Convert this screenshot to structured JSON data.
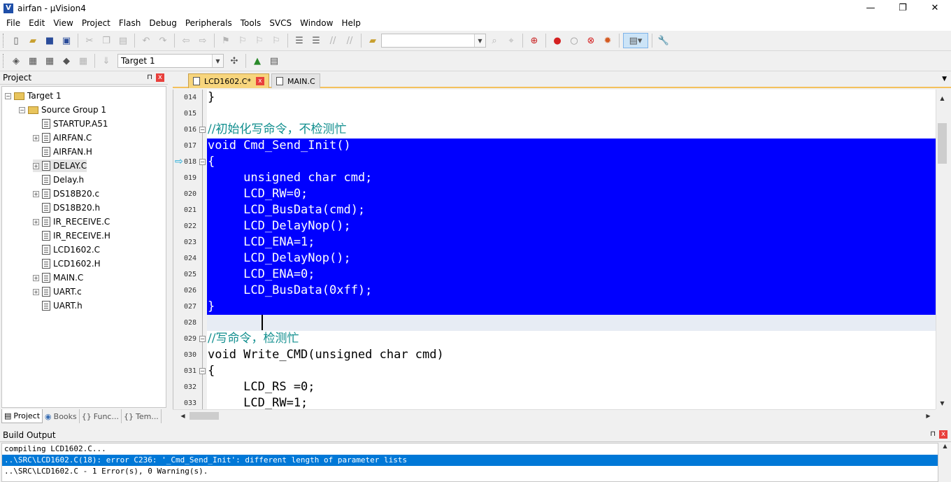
{
  "window": {
    "title": "airfan  - µVision4",
    "minimize": "—",
    "maximize": "❐",
    "close": "✕"
  },
  "menu": [
    "File",
    "Edit",
    "View",
    "Project",
    "Flash",
    "Debug",
    "Peripherals",
    "Tools",
    "SVCS",
    "Window",
    "Help"
  ],
  "toolbar2": {
    "target_value": "Target 1"
  },
  "project_panel": {
    "title": "Project",
    "pin": "⊓",
    "close": "x",
    "tree": {
      "target": "Target 1",
      "group": "Source Group 1",
      "files": [
        {
          "name": "STARTUP.A51",
          "expandable": false
        },
        {
          "name": "AIRFAN.C",
          "expandable": true
        },
        {
          "name": "AIRFAN.H",
          "expandable": false
        },
        {
          "name": "DELAY.C",
          "expandable": true
        },
        {
          "name": "Delay.h",
          "expandable": false
        },
        {
          "name": "DS18B20.c",
          "expandable": true
        },
        {
          "name": "DS18B20.h",
          "expandable": false
        },
        {
          "name": "IR_RECEIVE.C",
          "expandable": true
        },
        {
          "name": "IR_RECEIVE.H",
          "expandable": false
        },
        {
          "name": "LCD1602.C",
          "expandable": false
        },
        {
          "name": "LCD1602.H",
          "expandable": false
        },
        {
          "name": "MAIN.C",
          "expandable": true
        },
        {
          "name": "UART.c",
          "expandable": true
        },
        {
          "name": "UART.h",
          "expandable": false
        }
      ]
    },
    "tabs": [
      "Project",
      "Books",
      "Func...",
      "Tem..."
    ]
  },
  "editor": {
    "tabs": [
      {
        "label": "LCD1602.C*",
        "active": true
      },
      {
        "label": "MAIN.C",
        "active": false
      }
    ],
    "lines": [
      {
        "num": "014",
        "text": "}",
        "fold": false,
        "highlight": false
      },
      {
        "num": "015",
        "text": "",
        "fold": false,
        "highlight": false
      },
      {
        "num": "016",
        "text": "//初始化写命令，不检测忙",
        "fold": true,
        "comment": true,
        "highlight": false
      },
      {
        "num": "017",
        "text": "void Cmd_Send_Init()",
        "fold": false,
        "highlight": true
      },
      {
        "num": "018",
        "text": "{",
        "fold": true,
        "highlight": true,
        "marker": true
      },
      {
        "num": "019",
        "text": "     unsigned char cmd;",
        "fold": false,
        "highlight": true
      },
      {
        "num": "020",
        "text": "     LCD_RW=0;",
        "fold": false,
        "highlight": true
      },
      {
        "num": "021",
        "text": "     LCD_BusData(cmd);",
        "fold": false,
        "highlight": true
      },
      {
        "num": "022",
        "text": "     LCD_DelayNop();",
        "fold": false,
        "highlight": true
      },
      {
        "num": "023",
        "text": "     LCD_ENA=1;",
        "fold": false,
        "highlight": true
      },
      {
        "num": "024",
        "text": "     LCD_DelayNop();",
        "fold": false,
        "highlight": true
      },
      {
        "num": "025",
        "text": "     LCD_ENA=0;",
        "fold": false,
        "highlight": true
      },
      {
        "num": "026",
        "text": "     LCD_BusData(0xff);",
        "fold": false,
        "highlight": true
      },
      {
        "num": "027",
        "text": "}",
        "fold": false,
        "highlight": true
      },
      {
        "num": "028",
        "text": "",
        "fold": false,
        "highlight": false,
        "current": true
      },
      {
        "num": "029",
        "text": "//写命令，检测忙",
        "fold": true,
        "comment": true,
        "highlight": false
      },
      {
        "num": "030",
        "text": "void Write_CMD(unsigned char cmd)",
        "fold": false,
        "highlight": false
      },
      {
        "num": "031",
        "text": "{",
        "fold": true,
        "highlight": false
      },
      {
        "num": "032",
        "text": "     LCD_RS =0;",
        "fold": false,
        "highlight": false
      },
      {
        "num": "033",
        "text": "     LCD_RW=1;",
        "fold": false,
        "highlight": false
      }
    ]
  },
  "build_output": {
    "title": "Build Output",
    "lines": [
      {
        "text": "compiling LCD1602.C...",
        "selected": false
      },
      {
        "text": "..\\SRC\\LCD1602.C(18): error C236: '_Cmd_Send_Init': different length of parameter lists",
        "selected": true
      },
      {
        "text": "..\\SRC\\LCD1602.C - 1 Error(s), 0 Warning(s).",
        "selected": false
      }
    ]
  },
  "colors": {
    "selection": "#0000ff",
    "comment": "#108e8e",
    "tab_active": "#f7d57d",
    "build_selected": "#0078d7"
  }
}
